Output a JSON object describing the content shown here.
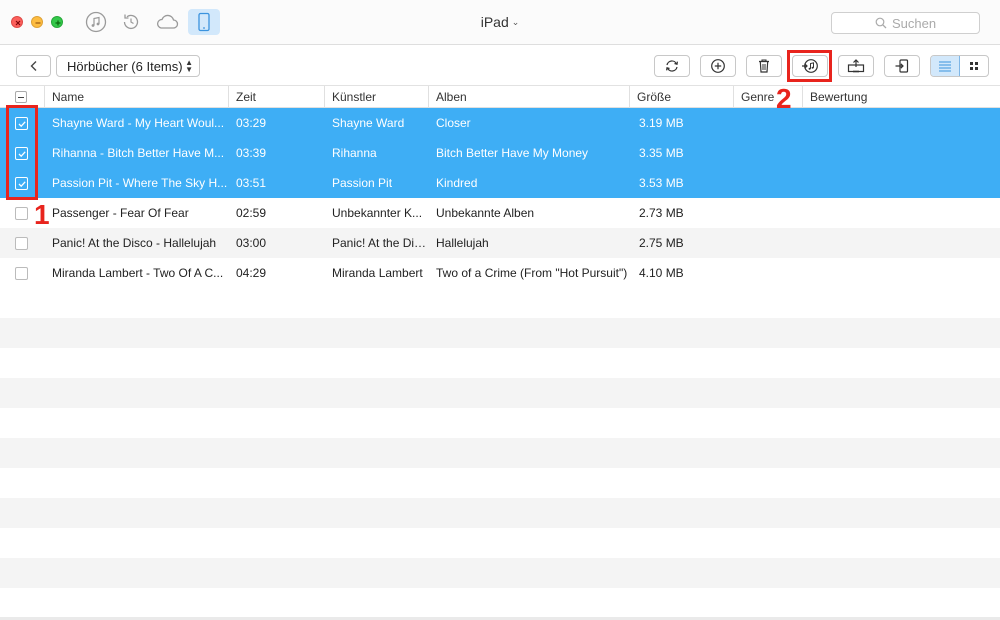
{
  "window": {
    "device_title": "iPad",
    "search_placeholder": "Suchen"
  },
  "toolbar": {
    "category_label": "Hörbücher (6 Items)"
  },
  "table": {
    "columns": [
      "Name",
      "Zeit",
      "Künstler",
      "Alben",
      "Größe",
      "Genre",
      "Bewertung"
    ],
    "rows": [
      {
        "name": "Shayne Ward - My Heart Woul...",
        "time": "03:29",
        "artist": "Shayne Ward",
        "album": "Closer",
        "size": "3.19 MB",
        "selected": true
      },
      {
        "name": "Rihanna - Bitch Better Have M...",
        "time": "03:39",
        "artist": "Rihanna",
        "album": "Bitch Better Have My Money",
        "size": "3.35 MB",
        "selected": true
      },
      {
        "name": "Passion Pit - Where The Sky H...",
        "time": "03:51",
        "artist": "Passion Pit",
        "album": "Kindred",
        "size": "3.53 MB",
        "selected": true
      },
      {
        "name": "Passenger - Fear Of Fear",
        "time": "02:59",
        "artist": "Unbekannter K...",
        "album": "Unbekannte Alben",
        "size": "2.73 MB",
        "selected": false
      },
      {
        "name": "Panic! At the Disco - Hallelujah",
        "time": "03:00",
        "artist": "Panic! At the Disco",
        "album": "Hallelujah",
        "size": "2.75 MB",
        "selected": false
      },
      {
        "name": "Miranda Lambert - Two Of A C...",
        "time": "04:29",
        "artist": "Miranda Lambert",
        "album": "Two of a Crime (From \"Hot Pursuit\")",
        "size": "4.10 MB",
        "selected": false
      }
    ]
  },
  "annotations": {
    "step1": "1",
    "step2": "2",
    "color": "#e8241d"
  },
  "colors": {
    "selection": "#3eaef5",
    "active_tab": "#d2e8fb"
  }
}
